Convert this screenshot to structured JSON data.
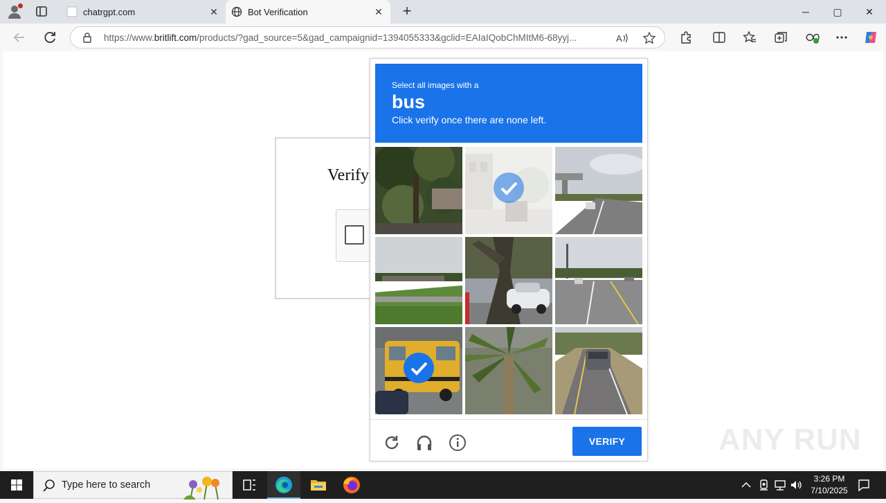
{
  "browser": {
    "tabs": [
      {
        "title": "chatrgpt.com",
        "active": false
      },
      {
        "title": "Bot Verification",
        "active": true
      }
    ],
    "url_prefix": "https://www.",
    "url_domain": "britlift.com",
    "url_rest": "/products/?gad_source=5&gad_campaignid=1394055333&gclid=EAIaIQobChMItM6-68yyj...",
    "window_controls": {
      "minimize": "─",
      "maximize": "▢",
      "close": "✕"
    }
  },
  "page": {
    "heading": "Verifyi"
  },
  "captcha": {
    "instruction_line1": "Select all images with a",
    "target_word": "bus",
    "instruction_line3": "Click verify once there are none left.",
    "verify_label": "VERIFY",
    "tiles": [
      {
        "selected": false,
        "scene": "trees"
      },
      {
        "selected": true,
        "scene": "faded-street"
      },
      {
        "selected": false,
        "scene": "overpass-road"
      },
      {
        "selected": false,
        "scene": "grass-bridge"
      },
      {
        "selected": false,
        "scene": "tree-car"
      },
      {
        "selected": false,
        "scene": "road-cars"
      },
      {
        "selected": true,
        "scene": "school-bus"
      },
      {
        "selected": false,
        "scene": "palm"
      },
      {
        "selected": false,
        "scene": "road-car-rear"
      }
    ]
  },
  "watermark": "ANY RUN",
  "taskbar": {
    "search_placeholder": "Type here to search",
    "time": "3:26 PM",
    "date": "7/10/2025"
  },
  "colors": {
    "accent": "#1a73e8",
    "taskbar": "#1f1f1f"
  }
}
